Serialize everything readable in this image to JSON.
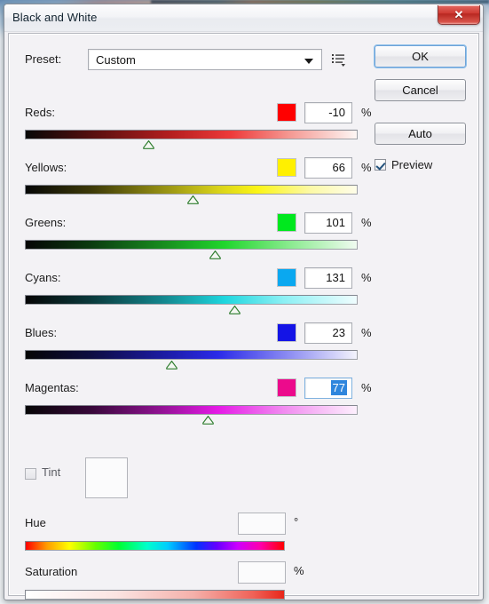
{
  "window": {
    "title": "Black and White",
    "close_label": "✕",
    "close_icon": "close-icon"
  },
  "preset": {
    "label": "Preset:",
    "value": "Custom",
    "arrow_icon": "chevron-down-icon",
    "menu_icon": "preset-options-icon"
  },
  "channels": [
    {
      "name": "Reds:",
      "value": "-10",
      "unit": "%",
      "swatch": "#FF0000",
      "thumb_pct": 37,
      "grad": "g-red",
      "focused": false,
      "selected": false,
      "key": "reds"
    },
    {
      "name": "Yellows:",
      "value": "66",
      "unit": "%",
      "swatch": "#FFF000",
      "thumb_pct": 50.5,
      "grad": "g-yellow",
      "focused": false,
      "selected": false,
      "key": "yellows"
    },
    {
      "name": "Greens:",
      "value": "101",
      "unit": "%",
      "swatch": "#00E81E",
      "thumb_pct": 57,
      "grad": "g-green",
      "focused": false,
      "selected": false,
      "key": "greens"
    },
    {
      "name": "Cyans:",
      "value": "131",
      "unit": "%",
      "swatch": "#0AA8F0",
      "thumb_pct": 63,
      "grad": "g-cyan",
      "focused": false,
      "selected": false,
      "key": "cyans"
    },
    {
      "name": "Blues:",
      "value": "23",
      "unit": "%",
      "swatch": "#1414E6",
      "thumb_pct": 44,
      "grad": "g-blue",
      "focused": false,
      "selected": false,
      "key": "blues"
    },
    {
      "name": "Magentas:",
      "value": "77",
      "unit": "%",
      "swatch": "#EC0A8C",
      "thumb_pct": 55,
      "grad": "g-magenta",
      "focused": true,
      "selected": true,
      "key": "magentas"
    }
  ],
  "tint": {
    "label": "Tint",
    "checked": false,
    "swatch_color": "#FBFBFC"
  },
  "hue": {
    "label": "Hue",
    "value": "",
    "unit": "°"
  },
  "saturation": {
    "label": "Saturation",
    "value": "",
    "unit": "%"
  },
  "buttons": {
    "ok": "OK",
    "cancel": "Cancel",
    "auto": "Auto",
    "preview_label": "Preview",
    "preview_checked": true
  },
  "accent": {
    "focus_ring": "#8FC0EA",
    "selection": "#2F86DD",
    "close_red": "#CF3A33"
  }
}
